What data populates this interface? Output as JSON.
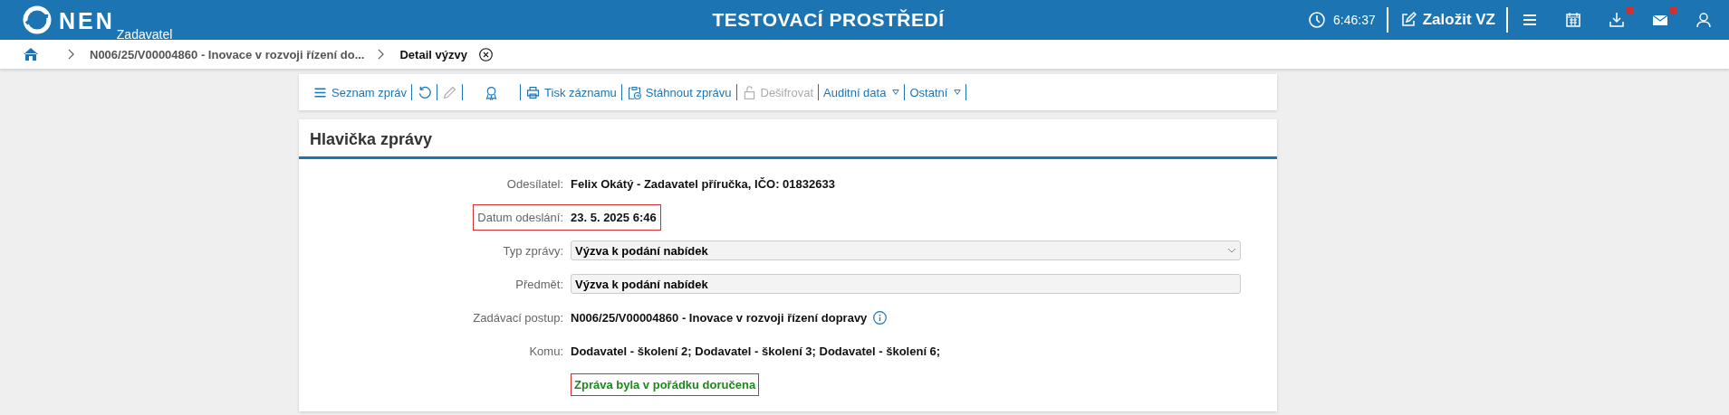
{
  "header": {
    "logo": "NEN",
    "role": "Zadavatel",
    "title": "TESTOVACÍ PROSTŘEDÍ",
    "time": "6:46:37",
    "create_button": "Založit VZ",
    "icons": [
      {
        "kind": "menu",
        "badge": false
      },
      {
        "kind": "calendar",
        "badge": false
      },
      {
        "kind": "download",
        "badge": true
      },
      {
        "kind": "mail",
        "badge": true
      },
      {
        "kind": "user",
        "badge": false
      }
    ]
  },
  "breadcrumb": [
    {
      "label": "N006/25/V00004860 - Inovace v rozvoji řízení do...",
      "current": false
    },
    {
      "label": "Detail výzvy",
      "current": true
    }
  ],
  "toolbar": [
    {
      "kind": "menu",
      "label": "Seznam zpráv",
      "disabled": false,
      "dropdown": false
    },
    {
      "kind": "refresh",
      "disabled": false,
      "dropdown": false
    },
    {
      "kind": "pencil",
      "disabled": true,
      "dropdown": false
    },
    {
      "kind": "award",
      "disabled": false,
      "dropdown": false
    },
    {
      "kind": "print",
      "label": "Tisk záznamu",
      "disabled": false,
      "dropdown": false
    },
    {
      "kind": "clipboard",
      "label": "Stáhnout zprávu",
      "disabled": false,
      "dropdown": false
    },
    {
      "kind": "lock",
      "label": "Dešifrovat",
      "disabled": true,
      "dropdown": false
    },
    {
      "label": "Auditní data",
      "disabled": false,
      "dropdown": true
    },
    {
      "label": "Ostatní",
      "disabled": false,
      "dropdown": true
    }
  ],
  "panel": {
    "title": "Hlavička zprávy",
    "rows": [
      {
        "kind": "text",
        "label": "Odesílatel:",
        "value": "Felix Okátý - Zadavatel příručka, IČO: 01832633",
        "highlighted": false
      },
      {
        "kind": "text",
        "label": "Datum odeslání:",
        "value": "23. 5. 2025 6:46",
        "highlighted": true
      },
      {
        "kind": "select",
        "label": "Typ zprávy:",
        "value": "Výzva k podání nabídek",
        "highlighted": false
      },
      {
        "kind": "input",
        "label": "Předmět:",
        "value": "Výzva k podání nabídek",
        "highlighted": false
      },
      {
        "kind": "info",
        "label": "Zadávací postup:",
        "value": "N006/25/V00004860 - Inovace v rozvoji řízení dopravy",
        "highlighted": false
      },
      {
        "kind": "text",
        "label": "Komu:",
        "value": "Dodavatel - školení 2; Dodavatel - školení 3; Dodavatel - školení 6;",
        "highlighted": false
      }
    ],
    "status": {
      "text": "Zpráva byla v pořádku doručena",
      "highlighted": true
    }
  }
}
